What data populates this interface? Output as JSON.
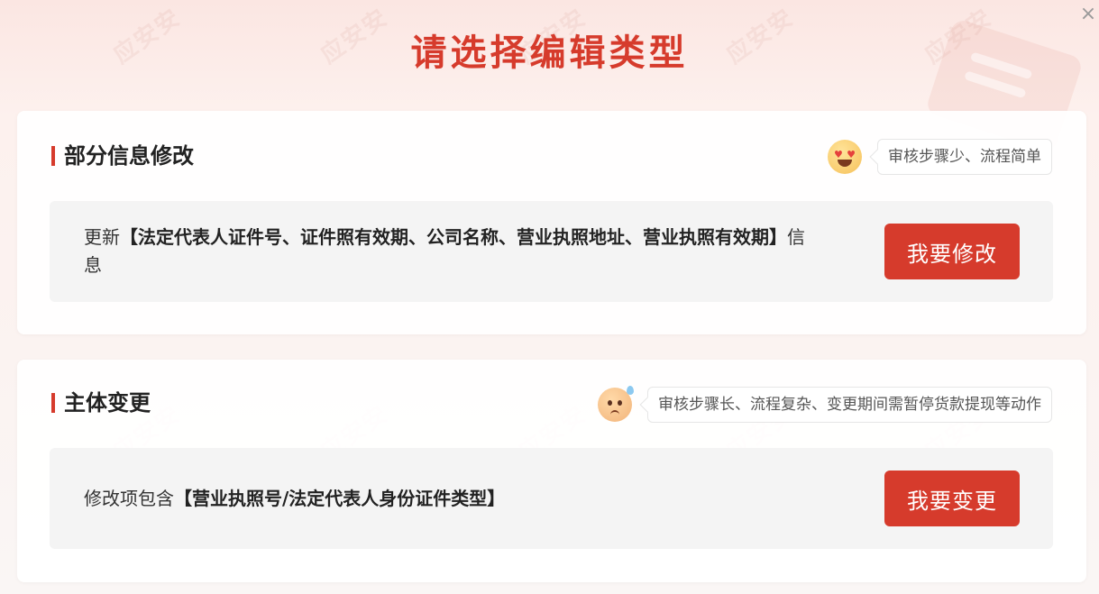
{
  "dialog": {
    "title": "请选择编辑类型",
    "watermark": "应安安"
  },
  "colors": {
    "accent": "#d63b2c"
  },
  "sections": [
    {
      "title": "部分信息修改",
      "tip": "审核步骤少、流程简单",
      "emoji": "heart-eyes-emoji-icon",
      "desc_prefix": "更新",
      "desc_bold": "【法定代表人证件号、证件照有效期、公司名称、营业执照地址、营业执照有效期】",
      "desc_suffix": "信息",
      "button": "我要修改"
    },
    {
      "title": "主体变更",
      "tip": "审核步骤长、流程复杂、变更期间需暂停货款提现等动作",
      "emoji": "sweat-face-emoji-icon",
      "desc_prefix": "修改项包含",
      "desc_bold": "【营业执照号/法定代表人身份证件类型】",
      "desc_suffix": "",
      "button": "我要变更"
    }
  ]
}
